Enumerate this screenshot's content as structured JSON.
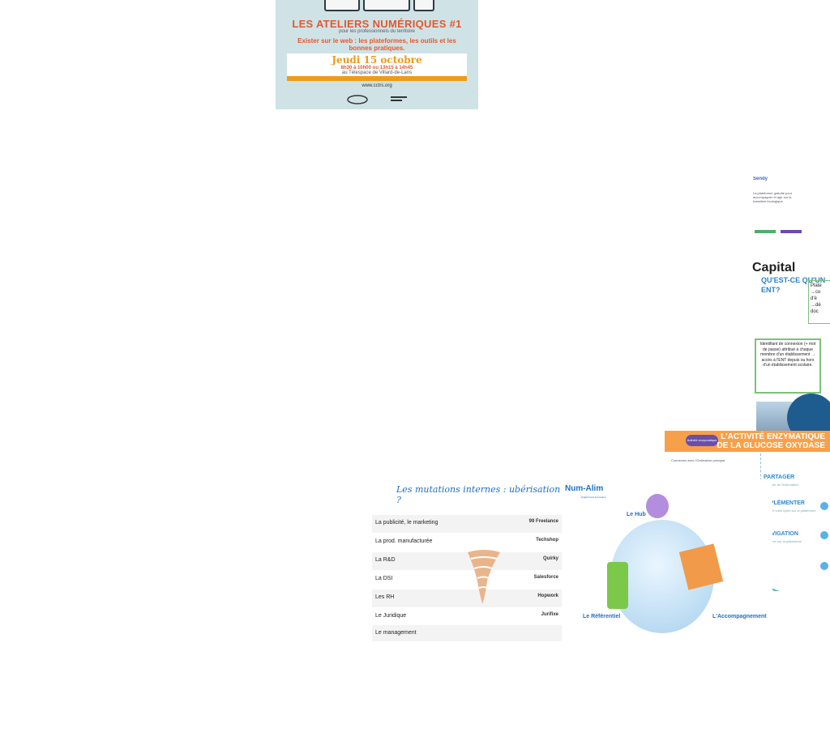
{
  "poster": {
    "title": "LES ATELIERS NUMÉRIQUES #1",
    "subtitle": "pour les professionnels du territoire",
    "description": "Exister sur le web : les plateformes, les outils et les bonnes pratiques.",
    "date": "Jeudi 15 octobre",
    "hours": "8h30 à 10h00 ou 13h15 à 14h45",
    "place": "au Télespace de Villard-de-Lans",
    "website": "www.cctrs.org"
  },
  "ent_slide": {
    "header": "Sendy",
    "intro": "La plateforme gratuite pour accompagner et agir sur la transition écologique",
    "brand": "Capital",
    "question": "QU'EST-CE QU'UN ENT?",
    "platform_label": "Plate",
    "platform_lines": [
      "→co",
      "d'é",
      "→dé",
      "doc"
    ],
    "identifier_text": "Identifiant de connexion (+ mot de passe) attribué à chaque membre d'un établissement → accès à l'ENT depuis ou hors d'un établissement scolaire."
  },
  "glucose_banner": {
    "tag": "Activité enzymatique",
    "title_line1": "L'ACTIVITÉ ENZYMATIQUE",
    "title_line2": "DE LA GLUCOSE OXYDASE"
  },
  "steps": {
    "connection": "Connexion avec l'Ordinateur principal",
    "items": [
      {
        "label": "PARTAGER",
        "desc": "Partager de l'information"
      },
      {
        "label": "IMPLÉMENTER",
        "desc": "Inscrire votre lycée sur la plateforme"
      },
      {
        "label": "NAVIGATION",
        "desc": "Naviguer sur la plateforme"
      },
      {
        "label": "",
        "desc": ""
      }
    ]
  },
  "mutations": {
    "title": "Les mutations internes : ubérisation ?",
    "rows": [
      {
        "label": "La publicité, le marketing",
        "brand": "99 Freelance"
      },
      {
        "label": "La prod. manufacturée",
        "brand": "Techshop"
      },
      {
        "label": "La R&D",
        "brand": "Quirky"
      },
      {
        "label": "La DSI",
        "brand": "Salesforce"
      },
      {
        "label": "Les RH",
        "brand": "Hopwork"
      },
      {
        "label": "Le Juridique",
        "brand": "Jurifixe"
      },
      {
        "label": "Le management",
        "brand": ""
      }
    ]
  },
  "num_alim": {
    "logo": "Num-Alim",
    "sub": "Digital Food Innovation",
    "hub": "Le Hub",
    "referentiel": "Le Référentiel",
    "accompagnement": "L'Accompagnement"
  },
  "colors": {
    "poster_bg": "#cfe3e6",
    "poster_title": "#e4572e",
    "poster_accent": "#f09a1a",
    "glucose_bg": "#f6a14a",
    "blue_text": "#1f6fc2"
  }
}
